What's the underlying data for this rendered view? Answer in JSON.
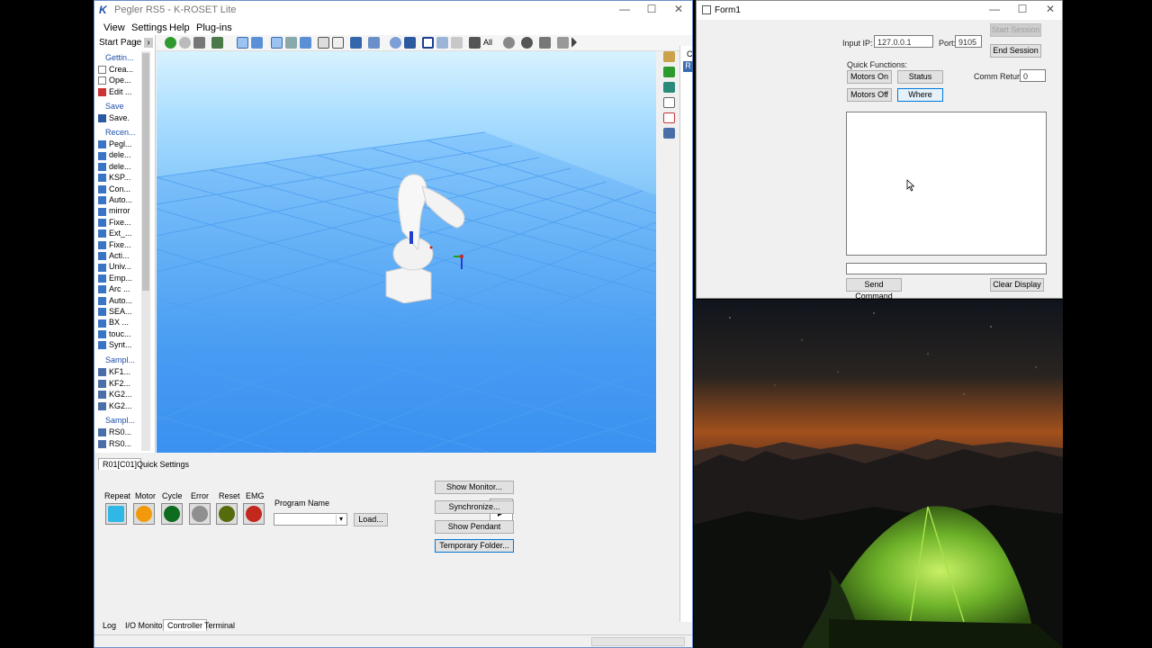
{
  "kroset": {
    "title": "Pegler RS5 - K-ROSET Lite",
    "menu": [
      "View",
      "Settings",
      "Help",
      "Plug-ins"
    ],
    "start_page_label": "Start Page",
    "start_page": {
      "getting_started": "Gettin...",
      "getting_items": [
        "Crea...",
        "Ope...",
        "Edit ..."
      ],
      "save_group": "Save",
      "save_items": [
        "Save."
      ],
      "recent_group": "Recen...",
      "recent_items": [
        "Pegl...",
        "dele...",
        "dele...",
        "KSP...",
        "Con...",
        "Auto...",
        "mirror",
        "Fixe...",
        "Ext_...",
        "Fixe...",
        "Acti...",
        "Univ...",
        "Emp...",
        "Arc ...",
        "Auto...",
        "SEA...",
        "BX ...",
        "touc...",
        "Synt..."
      ],
      "samples_group": "Sampl...",
      "samples_items": [
        "KF1...",
        "KF2...",
        "KG2...",
        "KG2..."
      ],
      "samples2_group": "Sampl...",
      "samples2_items": [
        "RS0...",
        "RS0..."
      ]
    },
    "toolbar_all": "All",
    "right_panel_c": "C",
    "right_panel_r": "R",
    "tabs_top": [
      "R01[C01]",
      "Quick Settings"
    ],
    "lamps": [
      {
        "label": "Repeat",
        "color": "#2fb8e6"
      },
      {
        "label": "Motor",
        "color": "#f29a0b"
      },
      {
        "label": "Cycle",
        "color": "#0f6b1d"
      },
      {
        "label": "Error",
        "color": "#8f8f8f"
      },
      {
        "label": "Reset",
        "color": "#556b0c"
      },
      {
        "label": "EMG",
        "color": "#c2281d"
      }
    ],
    "program_name_label": "Program Name",
    "load_button": "Load...",
    "show_monitor": "Show Monitor...",
    "synchronize": "Synchronize...",
    "show_pendant": "Show Pendant",
    "temporary_folder": "Temporary Folder...",
    "bottom_tabs": [
      "Log",
      "I/O Monitor",
      "Controller",
      "Terminal"
    ]
  },
  "form1": {
    "title": "Form1",
    "input_ip_label": "Input IP:",
    "input_ip_value": "127.0.0.1",
    "port_label": "Port:",
    "port_value": "9105",
    "start_session": "Start Session",
    "end_session": "End Session",
    "quick_functions_label": "Quick Functions:",
    "motors_on": "Motors On",
    "status": "Status",
    "motors_off": "Motors Off",
    "where": "Where",
    "comm_return_label": "Comm Return:",
    "comm_return_value": "0",
    "send_command": "Send Command",
    "clear_display": "Clear Display"
  }
}
